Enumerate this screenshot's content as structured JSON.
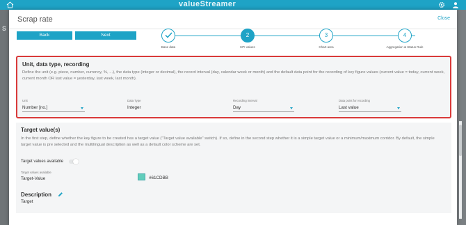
{
  "app": {
    "brand": "valueStreamer"
  },
  "background": {
    "sidebar_letter": "S"
  },
  "modal": {
    "title": "Scrap rate",
    "close_label": "Close"
  },
  "nav": {
    "back_label": "Back",
    "next_label": "Next"
  },
  "stepper": {
    "steps": [
      {
        "number": "1",
        "label": "Base data",
        "state": "done"
      },
      {
        "number": "2",
        "label": "KPI values",
        "state": "active"
      },
      {
        "number": "3",
        "label": "Chart area",
        "state": "pending"
      },
      {
        "number": "4",
        "label": "Aggregation & Status Rule",
        "state": "pending"
      }
    ]
  },
  "unit_section": {
    "title": "Unit, data type, recording",
    "description": "Define the unit (e.g. piece, number, currency, %, ...), the data type (integer or decimal), the record interval (day, calendar week or month) and the default data point for the recording of key figure values (current value = today, current week, current month OR last value = yesterday, last week, last month).",
    "fields": [
      {
        "label": "Unit",
        "value": "Number [no.]"
      },
      {
        "label": "Data Type",
        "value": "Integer"
      },
      {
        "label": "Recording interval",
        "value": "Day"
      },
      {
        "label": "Data point for recording",
        "value": "Last value"
      }
    ]
  },
  "target_section": {
    "title": "Target value(s)",
    "description": "In the first step, define whether the key figure to be created has a target value (\"Target value available\" switch). If so, define in the second step whether it is a simple target value or a minimum/maximum corridor. By default, the simple target value is pre selected and the multilingual description as well as a default color scheme are set.",
    "toggle_label": "Target values available",
    "small_label": "Target values available",
    "value": "Target-Value",
    "color_label": "#61CDBB",
    "color": "#61CDBB",
    "description_title": "Description",
    "description_value": "Target"
  },
  "colors": {
    "accent": "#1ea3c6",
    "highlight_border": "#d93a3a"
  }
}
